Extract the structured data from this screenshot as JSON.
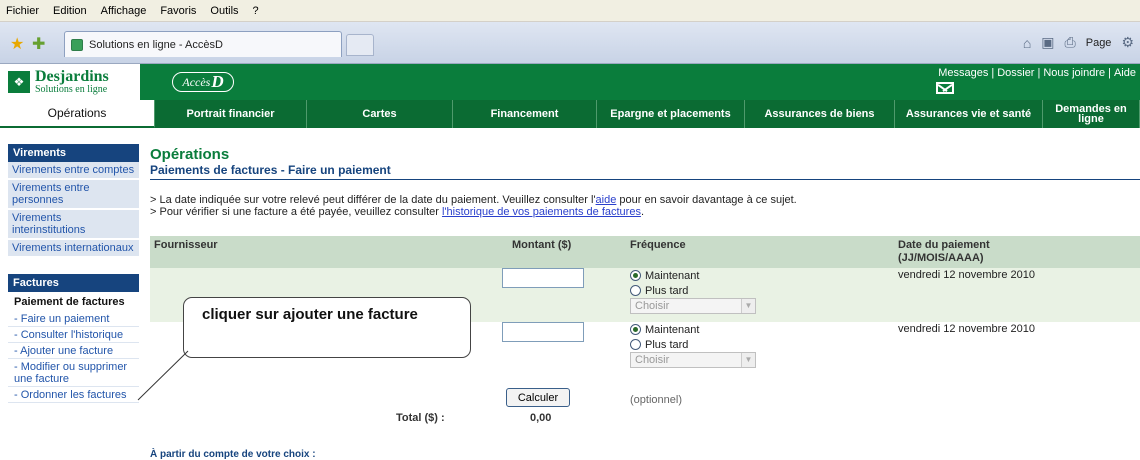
{
  "browser": {
    "menu": [
      "Fichier",
      "Edition",
      "Affichage",
      "Favoris",
      "Outils",
      "?"
    ],
    "tab_title": "Solutions en ligne - AccèsD",
    "page_label": "Page"
  },
  "header": {
    "brand": "Desjardins",
    "brand_sub": "Solutions en ligne",
    "accesd_prefix": "Accès",
    "accesd_d": "D",
    "links": [
      "Messages",
      "Dossier",
      "Nous joindre",
      "Aide"
    ],
    "brand_color": "#0a7d3c"
  },
  "nav": [
    {
      "label": "Opérations",
      "active": true
    },
    {
      "label": "Portrait financier"
    },
    {
      "label": "Cartes"
    },
    {
      "label": "Financement"
    },
    {
      "label": "Epargne et placements"
    },
    {
      "label": "Assurances de biens"
    },
    {
      "label": "Assurances vie et santé"
    },
    {
      "label": "Demandes en ligne"
    }
  ],
  "sidebar": {
    "virements_title": "Virements",
    "virements": [
      "Virements entre comptes",
      "Virements entre personnes",
      "Virements interinstitutions",
      "Virements internationaux"
    ],
    "factures_title": "Factures",
    "paiement_title": "Paiement de factures",
    "factures": [
      "- Faire un paiement",
      "- Consulter l'historique",
      "- Ajouter une facture",
      "- Modifier ou supprimer une facture",
      "- Ordonner les factures"
    ]
  },
  "main": {
    "title": "Opérations",
    "subtitle": "Paiements de factures - Faire un paiement",
    "note1_pre": "> La date indiquée sur votre relevé peut différer de la date du paiement. Veuillez consulter l'",
    "note1_link": "aide",
    "note1_post": " pour en savoir davantage à ce sujet.",
    "note2_pre": "> Pour vérifier si une facture a été payée, veuillez consulter ",
    "note2_link": "l'historique de vos paiements de factures",
    "note2_post": "."
  },
  "table": {
    "col_fournisseur": "Fournisseur",
    "col_montant": "Montant ($)",
    "col_frequence": "Fréquence",
    "col_date": "Date du paiement",
    "col_date_fmt": "(JJ/MOIS/AAAA)",
    "rows": [
      {
        "amount": "",
        "maintenant": "Maintenant",
        "plus_tard": "Plus tard",
        "choisir": "Choisir",
        "date": "vendredi 12 novembre 2010"
      },
      {
        "amount": "",
        "maintenant": "Maintenant",
        "plus_tard": "Plus tard",
        "choisir": "Choisir",
        "date": "vendredi 12 novembre 2010"
      }
    ],
    "calc_button": "Calculer",
    "optional": "(optionnel)",
    "total_label": "Total ($) :",
    "total_value": "0,00",
    "a_partir": "À partir du compte de votre choix :"
  },
  "callout": {
    "text": "cliquer sur ajouter une facture"
  }
}
